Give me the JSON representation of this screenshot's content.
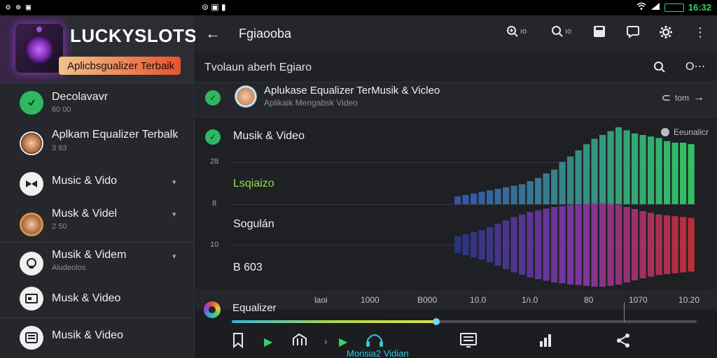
{
  "status_bar": {
    "left_icons": [
      "alarm-icon",
      "sim-icon",
      "notification-icon"
    ],
    "left_text": "ʘ ⊕ ▣",
    "mid_text": "⊜ ▣ ▮",
    "clock": "16:32"
  },
  "sidebar": {
    "brand_title": "LUCKYSLOTS",
    "brand_badge": "Aplicbsgualizer Terbaik",
    "items": [
      {
        "label": "Decolavavr",
        "sub": "60 00",
        "icon": "check-icon",
        "icon_color": "#2fb862"
      },
      {
        "label": "Aplkam Equalizer Terbalk",
        "sub": "3 93",
        "icon": "avatar-female",
        "icon_color": "#c98b62"
      },
      {
        "label": "Music & Vido",
        "sub": "",
        "icon": "bowtie-icon",
        "icon_color": "#f0f0f0"
      },
      {
        "label": "Musk & Videl",
        "sub": "2 50",
        "icon": "avatar-male",
        "icon_color": "#d89a3a"
      },
      {
        "label": "Musik & Videm",
        "sub": "Aludeolos",
        "icon": "headset-icon",
        "icon_color": "#f0f0f0"
      },
      {
        "label": "Musk & Video",
        "sub": "",
        "icon": "card-icon",
        "icon_color": "#f0f0f0"
      },
      {
        "label": "Musik & Video",
        "sub": "",
        "icon": "list-icon",
        "icon_color": "#f0f0f0"
      }
    ]
  },
  "topbar": {
    "title": "Fgiaooba",
    "zoom_in_label": "ıo",
    "zoom_out_label": "ıo"
  },
  "search_row": {
    "label": "Tvolaun aberh Egiaro"
  },
  "app_row": {
    "title": "Aplukase Equalizer TerMusik & Vicleo",
    "subtitle": "Aplikaik Mengabsk Video",
    "right_label": "tom"
  },
  "chart_panel": {
    "header": "Musik & Video",
    "corner_label": "Eeunalicr",
    "y_labels": [
      "28",
      "8",
      "10"
    ],
    "category_labels": [
      {
        "text": "Lsqiaizo",
        "color": "#8fe04a"
      },
      {
        "text": "Sogulán",
        "color": "#f0f0f0"
      },
      {
        "text": "B 603",
        "color": "#f0f0f0"
      }
    ]
  },
  "freq_axis": {
    "ticks": [
      "laoi",
      "1000",
      "B000",
      "10.0",
      "1/ı.0",
      "80",
      "1070",
      "10.20"
    ]
  },
  "equalizer": {
    "label": "Equalizer",
    "level": 0.44
  },
  "bottom_nav": {
    "items": [
      {
        "icon": "bookmark-icon",
        "label": ""
      },
      {
        "icon": "play-icon",
        "label": ""
      },
      {
        "icon": "chart-icon",
        "label": ""
      },
      {
        "icon": "chevron-right-icon",
        "label": ""
      },
      {
        "icon": "play-icon",
        "label": ""
      },
      {
        "icon": "headphones-icon",
        "label": "Morisia2 Vidian"
      },
      {
        "icon": "document-icon",
        "label": ""
      },
      {
        "icon": "bar-chart-icon",
        "label": ""
      },
      {
        "icon": "share-icon",
        "label": ""
      }
    ]
  },
  "chart_data": {
    "type": "bar",
    "title": "",
    "series": [
      {
        "name": "top",
        "values": [
          0.1,
          0.12,
          0.14,
          0.16,
          0.18,
          0.2,
          0.22,
          0.24,
          0.26,
          0.3,
          0.34,
          0.4,
          0.45,
          0.55,
          0.62,
          0.7,
          0.78,
          0.85,
          0.9,
          0.95,
          1.0,
          0.96,
          0.92,
          0.9,
          0.88,
          0.86,
          0.82,
          0.8,
          0.8,
          0.78
        ]
      },
      {
        "name": "bottom",
        "values": [
          0.2,
          0.25,
          0.3,
          0.35,
          0.42,
          0.5,
          0.58,
          0.66,
          0.72,
          0.78,
          0.82,
          0.86,
          0.9,
          0.92,
          0.95,
          0.96,
          0.98,
          1.0,
          1.0,
          0.98,
          0.95,
          0.9,
          0.85,
          0.8,
          0.76,
          0.72,
          0.7,
          0.68,
          0.66,
          0.64
        ]
      }
    ]
  }
}
